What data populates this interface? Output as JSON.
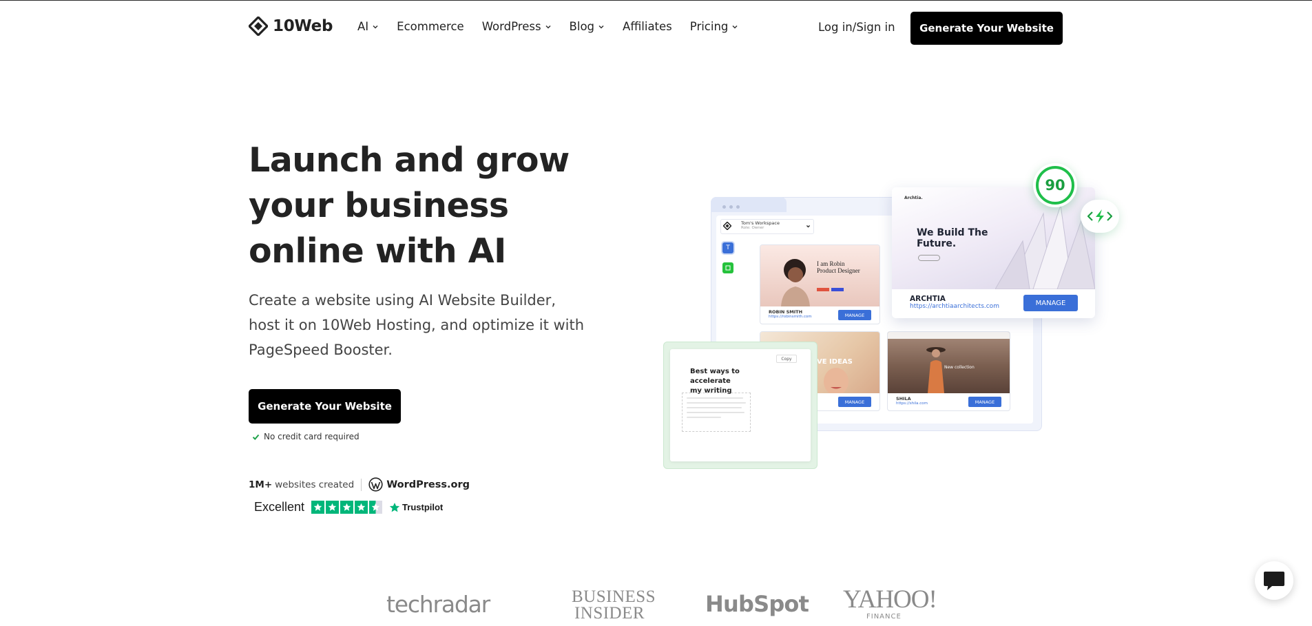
{
  "brand": {
    "name": "10Web"
  },
  "nav": {
    "items": [
      {
        "label": "AI",
        "dropdown": true
      },
      {
        "label": "Ecommerce",
        "dropdown": false
      },
      {
        "label": "WordPress",
        "dropdown": true
      },
      {
        "label": "Blog",
        "dropdown": true
      },
      {
        "label": "Affiliates",
        "dropdown": false
      },
      {
        "label": "Pricing",
        "dropdown": true
      }
    ],
    "login": "Log in/Sign in",
    "cta": "Generate Your Website"
  },
  "hero": {
    "title_lines": [
      "Launch and grow",
      "your business",
      "online with AI"
    ],
    "subtitle_lines": [
      "Create a website using AI Website Builder,",
      "host it on 10Web Hosting, and optimize it with",
      "PageSpeed Booster."
    ],
    "cta": "Generate Your Website",
    "no_credit_card": "No credit card required",
    "stat_value": "1M+",
    "stat_label": "websites created",
    "wordpress_label": "WordPress.org",
    "trustpilot": {
      "rating_word": "Excellent",
      "stars": 4.5,
      "brand": "Trustpilot"
    }
  },
  "mockup": {
    "workspace_name": "Tom's Workspace",
    "workspace_role": "Role: Owner",
    "sidebar_letter": "T",
    "score": "90",
    "sites": [
      {
        "name": "ROBIN SMITH",
        "url": "https://robinsmith.com",
        "manage": "MANAGE",
        "headline_lines": [
          "I am Robin",
          "Product Designer"
        ]
      },
      {
        "name": "",
        "url": "",
        "manage": "MANAGE",
        "headline_lines": [
          "VE IDEAS"
        ]
      },
      {
        "name": "SHILA",
        "url": "https://shila.com",
        "manage": "MANAGE",
        "headline_lines": [
          "New collection"
        ]
      }
    ],
    "featured": {
      "brand": "Archtia.",
      "headline_lines": [
        "We Build The",
        "Future."
      ],
      "name": "ARCHTIA",
      "url": "https://archtiaarchitects.com",
      "manage": "MANAGE"
    },
    "ai_writer": {
      "copy_label": "Copy",
      "title_lines": [
        "Best ways to accelerate",
        "my writing"
      ]
    }
  },
  "press_logos": [
    "techradar",
    "BUSINESS INSIDER",
    "HubSpot",
    "YAHOO!",
    "FINANCE"
  ],
  "colors": {
    "accent_blue": "#3a6fd8",
    "score_green": "#1fbf4a",
    "trustpilot_green": "#00b67a",
    "button_black": "#000000"
  }
}
